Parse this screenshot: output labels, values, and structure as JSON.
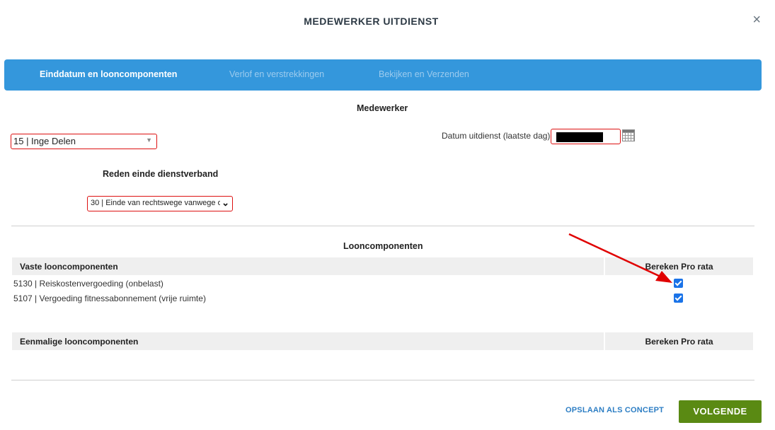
{
  "modal": {
    "title": "MEDEWERKER UITDIENST",
    "close_glyph": "×"
  },
  "stepper": {
    "steps": [
      {
        "label": "Einddatum en looncomponenten",
        "active": true
      },
      {
        "label": "Verlof en verstrekkingen",
        "active": false
      },
      {
        "label": "Bekijken en Verzenden",
        "active": false
      }
    ]
  },
  "employee_section": {
    "heading": "Medewerker",
    "employee_select_value": "15 | Inge Delen",
    "date_label": "Datum uitdienst (laatste dag)",
    "date_value_redacted": true
  },
  "reason_section": {
    "heading": "Reden einde dienstverband",
    "reason_select_value": "30 | Einde van rechtswege vanwege o"
  },
  "wage_components": {
    "heading": "Looncomponenten",
    "fixed": {
      "header_left": "Vaste looncomponenten",
      "header_right": "Bereken Pro rata",
      "rows": [
        {
          "label": "5130 | Reiskostenvergoeding (onbelast)",
          "pro_rata": true
        },
        {
          "label": "5107 | Vergoeding fitnessabonnement (vrije ruimte)",
          "pro_rata": true
        }
      ]
    },
    "one_time": {
      "header_left": "Eenmalige looncomponenten",
      "header_right": "Bereken Pro rata",
      "rows": []
    }
  },
  "footer": {
    "save_concept_label": "OPSLAAN ALS CONCEPT",
    "next_label": "VOLGENDE"
  },
  "colors": {
    "stepper_bg": "#3497dc",
    "next_button_bg": "#5a8a13",
    "validation_border": "#dd1111",
    "annotation_arrow": "#e00000"
  }
}
